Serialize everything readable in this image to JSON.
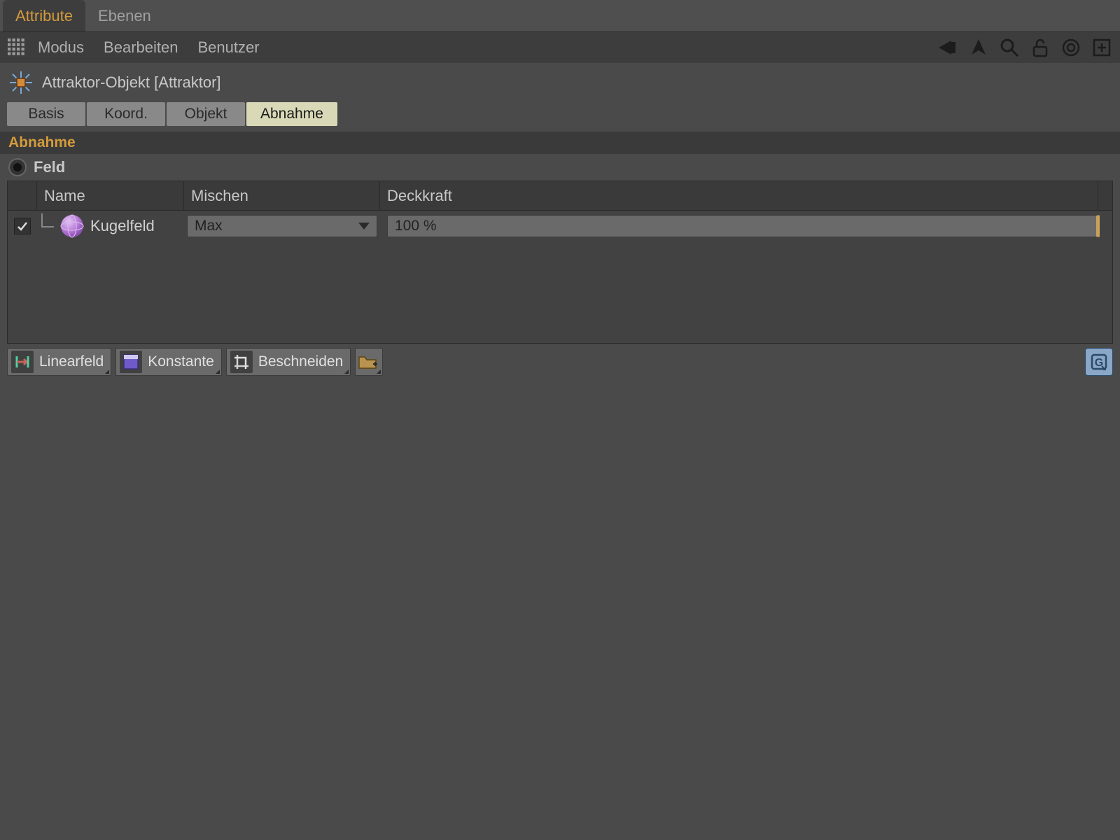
{
  "topTabs": {
    "active": "Attribute",
    "other": "Ebenen"
  },
  "menus": {
    "modus": "Modus",
    "bearbeiten": "Bearbeiten",
    "benutzer": "Benutzer"
  },
  "objectTitle": "Attraktor-Objekt [Attraktor]",
  "subTabs": {
    "basis": "Basis",
    "koord": "Koord.",
    "objekt": "Objekt",
    "abnahme": "Abnahme"
  },
  "sectionHeader": "Abnahme",
  "feldLabel": "Feld",
  "columns": {
    "name": "Name",
    "blend": "Mischen",
    "opacity": "Deckkraft"
  },
  "row": {
    "checked": true,
    "name": "Kugelfeld",
    "blend": "Max",
    "opacity": "100 %"
  },
  "bottomBar": {
    "linear": "Linearfeld",
    "constant": "Konstante",
    "clamp": "Beschneiden"
  }
}
